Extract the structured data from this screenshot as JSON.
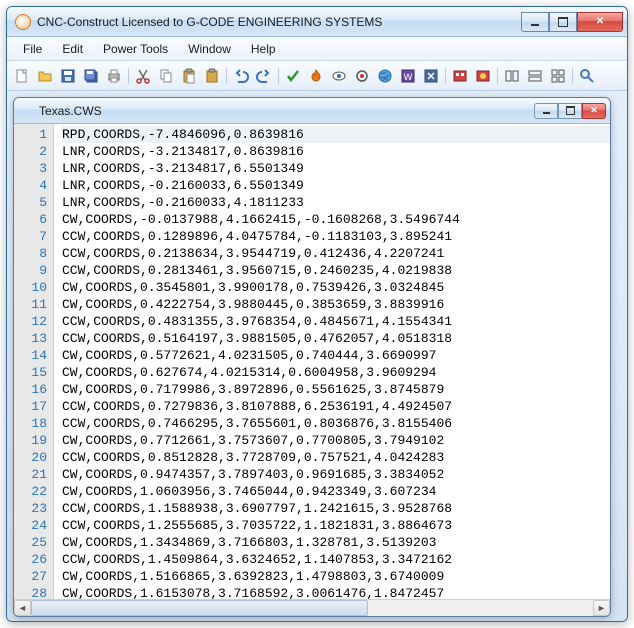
{
  "window": {
    "title": "CNC-Construct   Licensed to G-CODE ENGINEERING SYSTEMS"
  },
  "menu": {
    "items": [
      "File",
      "Edit",
      "Power Tools",
      "Window",
      "Help"
    ]
  },
  "toolbar": {
    "icons": [
      "new-file-icon",
      "open-folder-icon",
      "save-icon",
      "save-all-icon",
      "print-icon",
      "|",
      "cut-icon",
      "copy-icon",
      "paste-icon",
      "clipboard-icon",
      "|",
      "undo-icon",
      "redo-icon",
      "|",
      "check-icon",
      "flame-icon",
      "eye-icon",
      "target-icon",
      "globe-icon",
      "tool1-icon",
      "tool2-icon",
      "|",
      "tool3-icon",
      "tool4-icon",
      "|",
      "layout1-icon",
      "layout2-icon",
      "layout3-icon",
      "|",
      "search-icon"
    ]
  },
  "child": {
    "filename": "Texas.CWS"
  },
  "lines": [
    "RPD,COORDS,-7.4846096,0.8639816",
    "LNR,COORDS,-3.2134817,0.8639816",
    "LNR,COORDS,-3.2134817,6.5501349",
    "LNR,COORDS,-0.2160033,6.5501349",
    "LNR,COORDS,-0.2160033,4.1811233",
    "CW,COORDS,-0.0137988,4.1662415,-0.1608268,3.5496744",
    "CCW,COORDS,0.1289896,4.0475784,-0.1183103,3.895241",
    "CCW,COORDS,0.2138634,3.9544719,0.412436,4.2207241",
    "CCW,COORDS,0.2813461,3.9560715,0.2460235,4.0219838",
    "CW,COORDS,0.3545801,3.9900178,0.7539426,3.0324845",
    "CW,COORDS,0.4222754,3.9880445,0.3853659,3.8839916",
    "CCW,COORDS,0.4831355,3.9768354,0.4845671,4.1554341",
    "CCW,COORDS,0.5164197,3.9881505,0.4762057,4.0518318",
    "CW,COORDS,0.5772621,4.0231505,0.740444,3.6690997",
    "CW,COORDS,0.627674,4.0215314,0.6004958,3.9609294",
    "CW,COORDS,0.7179986,3.8972896,0.5561625,3.8745879",
    "CCW,COORDS,0.7279836,3.8107888,6.2536191,4.4924507",
    "CCW,COORDS,0.7466295,3.7655601,0.8036876,3.8155406",
    "CW,COORDS,0.7712661,3.7573607,0.7700805,3.7949102",
    "CCW,COORDS,0.8512828,3.7728709,0.757521,4.0424283",
    "CW,COORDS,0.9474357,3.7897403,0.9691685,3.3834052",
    "CW,COORDS,1.0603956,3.7465044,0.9423349,3.607234",
    "CCW,COORDS,1.1588938,3.6907797,1.2421615,3.9528768",
    "CCW,COORDS,1.2555685,3.7035722,1.1821831,3.8864673",
    "CW,COORDS,1.3434869,3.7166803,1.328781,3.5139203",
    "CCW,COORDS,1.4509864,3.6324652,1.1407853,3.3472162",
    "CW,COORDS,1.5166865,3.6392823,1.4798803,3.6740009",
    "CW,COORDS,1.6153078,3.7168592,3.0061476,1.8472457"
  ]
}
